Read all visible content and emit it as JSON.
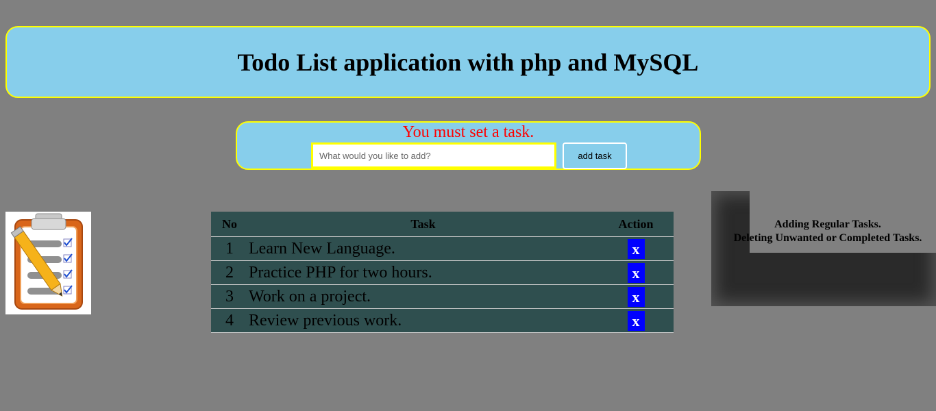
{
  "header": {
    "title": "Todo List application with php and MySQL"
  },
  "form": {
    "error": "You must set a task.",
    "input_placeholder": "What would you like to add?",
    "input_value": "",
    "submit_label": "add task"
  },
  "table": {
    "headers": {
      "no": "No",
      "task": "Task",
      "action": "Action"
    },
    "rows": [
      {
        "no": "1",
        "task": "Learn New Language.",
        "action": "x"
      },
      {
        "no": "2",
        "task": "Practice PHP for two hours.",
        "action": "x"
      },
      {
        "no": "3",
        "task": "Work on a project.",
        "action": "x"
      },
      {
        "no": "4",
        "task": "Review previous work.",
        "action": "x"
      }
    ]
  },
  "sidebar": {
    "lines": [
      "Adding Regular Tasks.",
      "Deleting Unwanted or Completed Tasks."
    ]
  },
  "logo": {
    "icon": "clipboard-checklist-pencil-icon"
  },
  "colors": {
    "page_bg": "#808080",
    "panel_bg": "#87ceeb",
    "panel_border": "#ffff00",
    "error_text": "#ff0000",
    "table_bg": "#2f4f4f",
    "delete_button": "#0000ff"
  }
}
